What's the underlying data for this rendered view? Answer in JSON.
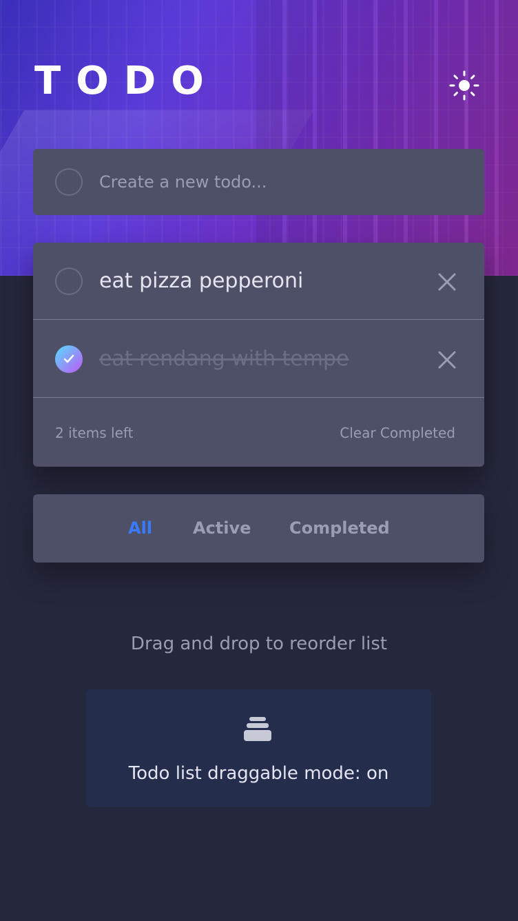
{
  "header": {
    "title": "TODO",
    "theme_icon": "sun-icon"
  },
  "new_todo": {
    "placeholder": "Create a new todo..."
  },
  "todos": [
    {
      "text": "eat pizza pepperoni",
      "completed": false
    },
    {
      "text": "eat rendang with tempe",
      "completed": true
    }
  ],
  "list_footer": {
    "items_left": "2 items left",
    "clear_label": "Clear Completed"
  },
  "filters": {
    "all": "All",
    "active": "Active",
    "completed": "Completed",
    "selected": "All"
  },
  "hint": "Drag and drop to reorder list",
  "drag_mode": {
    "icon": "stack-icon",
    "label": "Todo list draggable mode: on"
  },
  "colors": {
    "background": "#25273c",
    "card": "#4d5066",
    "accent": "#3a7bfd",
    "check_gradient_start": "#55ddff",
    "check_gradient_end": "#c058f3"
  }
}
